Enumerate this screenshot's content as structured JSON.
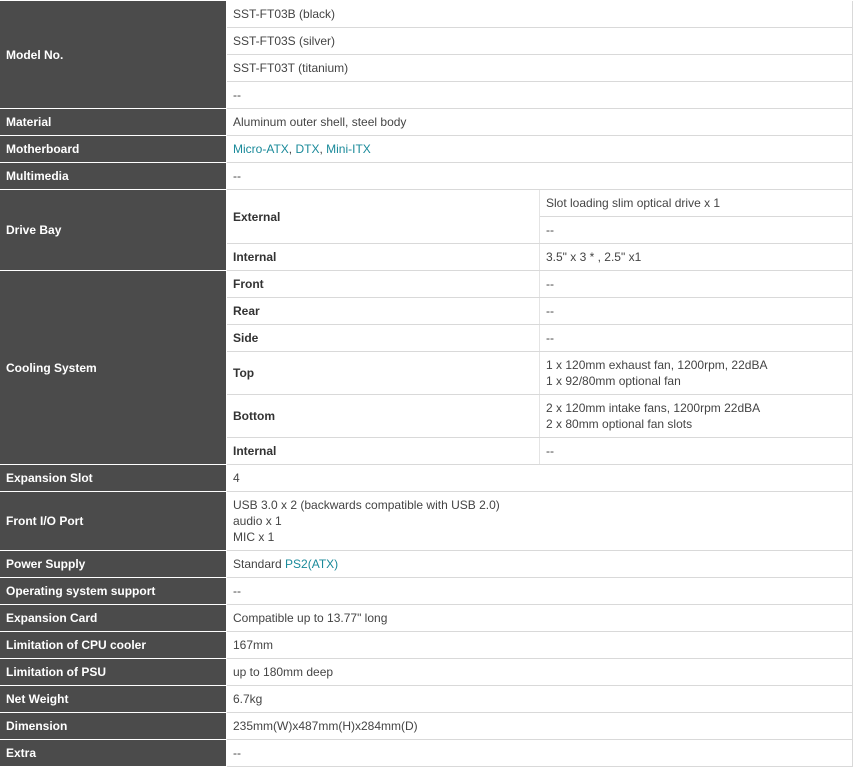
{
  "labels": {
    "model": "Model No.",
    "material": "Material",
    "motherboard": "Motherboard",
    "multimedia": "Multimedia",
    "drive_bay": "Drive Bay",
    "cooling": "Cooling System",
    "expansion_slot": "Expansion Slot",
    "front_io": "Front I/O Port",
    "power_supply": "Power Supply",
    "os_support": "Operating system support",
    "expansion_card": "Expansion Card",
    "cpu_cooler": "Limitation of CPU cooler",
    "psu_limit": "Limitation of PSU",
    "net_weight": "Net Weight",
    "dimension": "Dimension",
    "extra": "Extra"
  },
  "model": [
    "SST-FT03B (black)",
    "SST-FT03S (silver)",
    "SST-FT03T (titanium)",
    "--"
  ],
  "material": "Aluminum outer shell, steel body",
  "motherboard": {
    "links": [
      "Micro-ATX",
      "DTX",
      "Mini-ITX"
    ],
    "sep1": ", ",
    "sep2": ", "
  },
  "multimedia": "--",
  "drive_bay": {
    "external_label": "External",
    "external": [
      "Slot loading slim optical drive x 1",
      "--"
    ],
    "internal_label": "Internal",
    "internal": "3.5\" x 3 * , 2.5\" x1"
  },
  "cooling": {
    "front_label": "Front",
    "front": "--",
    "rear_label": "Rear",
    "rear": "--",
    "side_label": "Side",
    "side": "--",
    "top_label": "Top",
    "top": [
      "1 x 120mm exhaust fan, 1200rpm, 22dBA",
      "1 x 92/80mm optional fan"
    ],
    "bottom_label": "Bottom",
    "bottom": [
      "2 x 120mm intake fans, 1200rpm 22dBA",
      "2 x 80mm optional fan slots"
    ],
    "internal_label": "Internal",
    "internal": "--"
  },
  "expansion_slot": "4",
  "front_io": [
    "USB 3.0 x 2 (backwards compatible with USB 2.0)",
    "audio x 1",
    "MIC x 1"
  ],
  "power_supply": {
    "prefix": "Standard ",
    "link": "PS2(ATX)"
  },
  "os_support": "--",
  "expansion_card": "Compatible up to 13.77\" long",
  "cpu_cooler": "167mm",
  "psu_limit": "up to 180mm deep",
  "net_weight": "6.7kg",
  "dimension": "235mm(W)x487mm(H)x284mm(D)",
  "extra": "--",
  "colors": {
    "header_bg": "#4b4b4b",
    "link": "#1a8a9a",
    "text": "#444444"
  }
}
